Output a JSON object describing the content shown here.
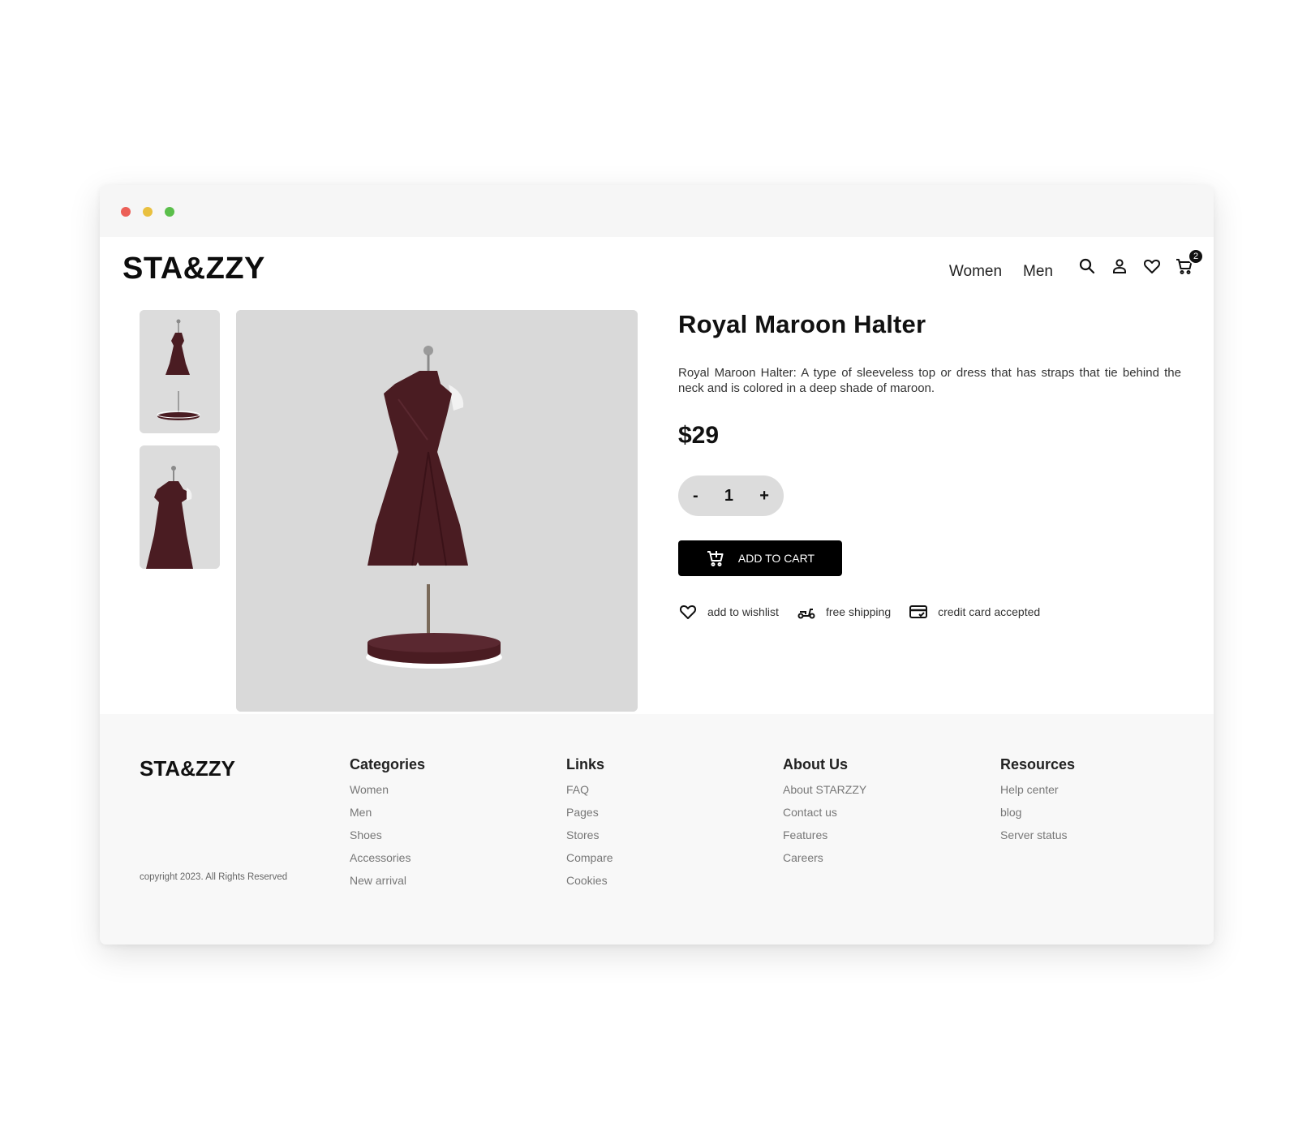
{
  "brand": {
    "logo": "STA&ZZY"
  },
  "nav": {
    "items": [
      "Women",
      "Men"
    ]
  },
  "header_icons": {
    "search": "search-icon",
    "account": "user-icon",
    "wishlist": "heart-icon",
    "cart": "cart-icon",
    "cart_count": "2"
  },
  "product": {
    "title": "Royal Maroon Halter",
    "description": "Royal Maroon Halter: A type of sleeveless top or dress that has straps that tie behind the neck and is colored in a deep shade of maroon.",
    "price": "$29",
    "quantity": {
      "minus": "-",
      "value": "1",
      "plus": "+"
    },
    "add_to_cart": "ADD TO CART",
    "features": [
      {
        "icon": "heart-icon",
        "label": "add to wishlist"
      },
      {
        "icon": "scooter-icon",
        "label": "free shipping"
      },
      {
        "icon": "credit-card-icon",
        "label": "credit card accepted"
      }
    ],
    "colors": {
      "dress": "#4a1c22",
      "image_bg": "#d9d9d9"
    }
  },
  "footer": {
    "logo": "STA&ZZY",
    "copyright": "copyright 2023. All Rights Reserved",
    "columns": [
      {
        "title": "Categories",
        "links": [
          "Women",
          "Men",
          "Shoes",
          "Accessories",
          "New arrival"
        ]
      },
      {
        "title": "Links",
        "links": [
          "FAQ",
          "Pages",
          "Stores",
          "Compare",
          "Cookies"
        ]
      },
      {
        "title": "About Us",
        "links": [
          "About STARZZY",
          "Contact us",
          "Features",
          "Careers"
        ]
      },
      {
        "title": "Resources",
        "links": [
          "Help center",
          "blog",
          "Server status"
        ]
      }
    ]
  }
}
